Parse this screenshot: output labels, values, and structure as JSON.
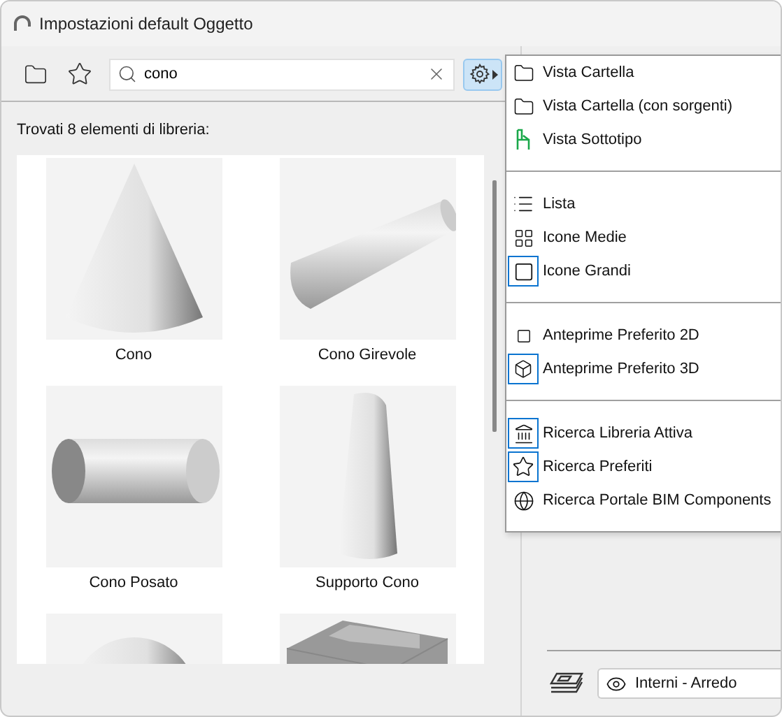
{
  "window": {
    "title": "Impostazioni default Oggetto"
  },
  "search": {
    "value": "cono"
  },
  "results_label": "Trovati 8 elementi di libreria:",
  "library_items": [
    {
      "label": "Cono",
      "kind": "picture"
    },
    {
      "label": "Cono Girevole",
      "kind": "picture"
    },
    {
      "label": "Cono Posato",
      "kind": "picture"
    },
    {
      "label": "Supporto Cono",
      "kind": "picture"
    },
    {
      "kind": "picture"
    },
    {
      "kind": "picture"
    }
  ],
  "view_menu": {
    "groups": [
      {
        "items": [
          {
            "label": "Vista Cartella",
            "selected": false
          },
          {
            "label": "Vista Cartella (con sorgenti)",
            "selected": false
          },
          {
            "label": "Vista Sottotipo",
            "selected": false
          }
        ]
      },
      {
        "items": [
          {
            "label": "Lista",
            "selected": false
          },
          {
            "label": "Icone Medie",
            "selected": false
          },
          {
            "label": "Icone Grandi",
            "selected": true
          }
        ]
      },
      {
        "items": [
          {
            "label": "Anteprime Preferito 2D",
            "selected": false
          },
          {
            "label": "Anteprime Preferito 3D",
            "selected": true
          }
        ]
      },
      {
        "items": [
          {
            "label": "Ricerca Libreria Attiva",
            "selected": true
          },
          {
            "label": "Ricerca Preferiti",
            "selected": true
          },
          {
            "label": "Ricerca Portale BIM Components",
            "selected": false
          }
        ]
      }
    ]
  },
  "layer_select": {
    "value": "Interni - Arredo"
  }
}
